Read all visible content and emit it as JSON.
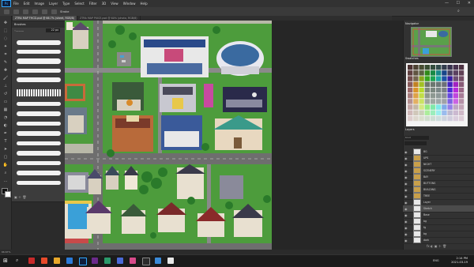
{
  "app": {
    "logo": "Ps"
  },
  "menu": [
    "File",
    "Edit",
    "Image",
    "Layer",
    "Type",
    "Select",
    "Filter",
    "3D",
    "View",
    "Window",
    "Help"
  ],
  "window_controls": {
    "minimize": "—",
    "maximize": "☐",
    "close": "✕"
  },
  "options_bar": {
    "text": "Stroke"
  },
  "tabs": [
    {
      "label": "ZTRA MAP FHCD.psd @ 66.7% (sheet, RGB/8)",
      "active": true
    },
    {
      "label": "ZTRA MAP PIXCE.psd @ 60% (photo, RGB/8)",
      "active": false
    }
  ],
  "brush_panel": {
    "title": "Brushes",
    "size_value": "22 px"
  },
  "right_panels": {
    "navigator_title": "Navigator",
    "swatches_title": "Swatches",
    "layers_title": "Layers"
  },
  "layers": [
    {
      "name": "BG",
      "type": "layer"
    },
    {
      "name": "UPS",
      "type": "folder"
    },
    {
      "name": "NIGHT",
      "type": "folder"
    },
    {
      "name": "SCENERY",
      "type": "folder"
    },
    {
      "name": "BAY",
      "type": "folder"
    },
    {
      "name": "BUTTONS",
      "type": "folder"
    },
    {
      "name": "BUILDING",
      "type": "folder"
    },
    {
      "name": "TREE",
      "type": "folder"
    },
    {
      "name": "Layer",
      "type": "layer"
    },
    {
      "name": "Sketch",
      "type": "layer",
      "selected": true
    },
    {
      "name": "Base",
      "type": "layer"
    },
    {
      "name": "bg",
      "type": "layer"
    },
    {
      "name": "fg",
      "type": "layer"
    },
    {
      "name": "bg",
      "type": "layer"
    },
    {
      "name": "dark",
      "type": "layer"
    }
  ],
  "status_bar": {
    "text": "66.67%"
  },
  "taskbar": {
    "time": "2:14 PM",
    "date": "2021-03-19",
    "lang": "ENG"
  },
  "colors": {
    "accent": "#31a8ff",
    "grass": "#4a9a3a",
    "road": "#707070"
  }
}
